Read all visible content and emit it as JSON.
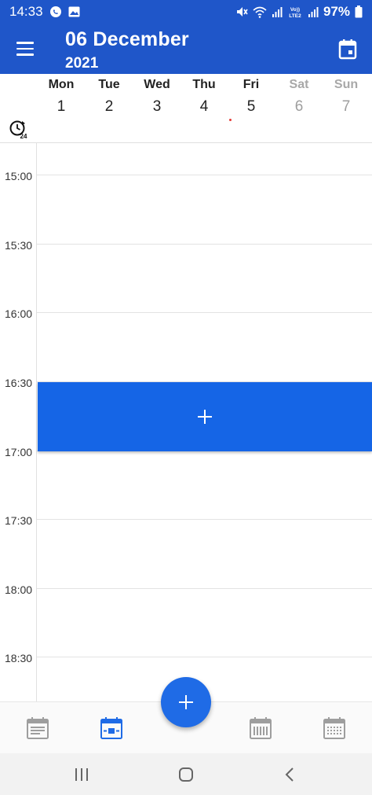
{
  "status_bar": {
    "time": "14:33",
    "battery": "97%",
    "icons": [
      "whatsapp-icon",
      "gallery-icon",
      "mute-icon",
      "wifi-icon",
      "signal-icon",
      "volte-lte2-icon",
      "signal-icon",
      "battery-icon"
    ]
  },
  "header": {
    "title_day": "06 December",
    "title_year": "2021",
    "menu_icon": "hamburger-menu-icon",
    "today_icon": "calendar-today-icon"
  },
  "week": {
    "days": [
      {
        "name": "Mon",
        "num": "1",
        "weekend": false
      },
      {
        "name": "Tue",
        "num": "2",
        "weekend": false
      },
      {
        "name": "Wed",
        "num": "3",
        "weekend": false
      },
      {
        "name": "Thu",
        "num": "4",
        "weekend": false
      },
      {
        "name": "Fri",
        "num": "5",
        "weekend": false
      },
      {
        "name": "Sat",
        "num": "6",
        "weekend": true
      },
      {
        "name": "Sun",
        "num": "7",
        "weekend": true
      }
    ],
    "clock_icon": "clock-24h-icon"
  },
  "grid": {
    "times": [
      "15:00",
      "15:30",
      "16:00",
      "16:30",
      "17:00",
      "17:30",
      "18:00",
      "18:30"
    ],
    "new_event_icon": "plus-icon",
    "accent": "#1565e6"
  },
  "bottom_nav": {
    "items": [
      "agenda-view-icon",
      "day-view-icon",
      "week-view-icon",
      "month-view-icon"
    ],
    "active": "day-view-icon",
    "fab_icon": "plus-icon"
  },
  "colors": {
    "primary": "#1f56c9",
    "fab": "#1f6be6",
    "weekend_text": "#9e9e9e"
  }
}
